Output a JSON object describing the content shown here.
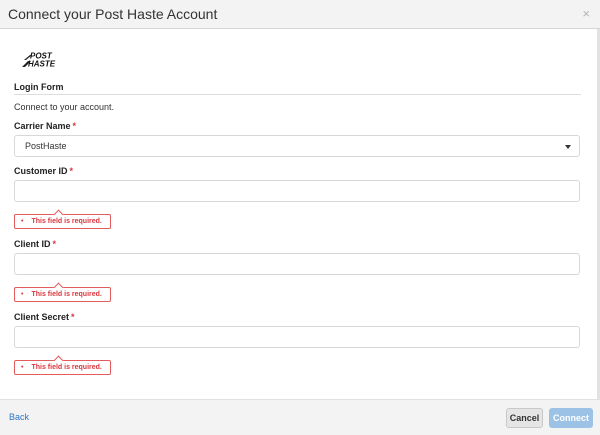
{
  "dialog": {
    "title": "Connect your Post Haste Account",
    "close_glyph": "×"
  },
  "logo": {
    "line1": "POST",
    "line2": "HASTE"
  },
  "form": {
    "section_title": "Login Form",
    "intro": "Connect to your account.",
    "required_mark": "*",
    "carrier": {
      "label": "Carrier Name",
      "selected": "PostHaste"
    },
    "customer_id": {
      "label": "Customer ID",
      "value": ""
    },
    "client_id": {
      "label": "Client ID",
      "value": ""
    },
    "client_secret": {
      "label": "Client Secret",
      "value": ""
    },
    "error": {
      "bullet": "•",
      "text": "This field is required."
    }
  },
  "footer": {
    "back_label": "Back",
    "cancel_label": "Cancel",
    "connect_label": "Connect"
  },
  "colors": {
    "accent": "#2a77c6",
    "error": "#d9363e",
    "connect_disabled": "#9cc3e6"
  }
}
